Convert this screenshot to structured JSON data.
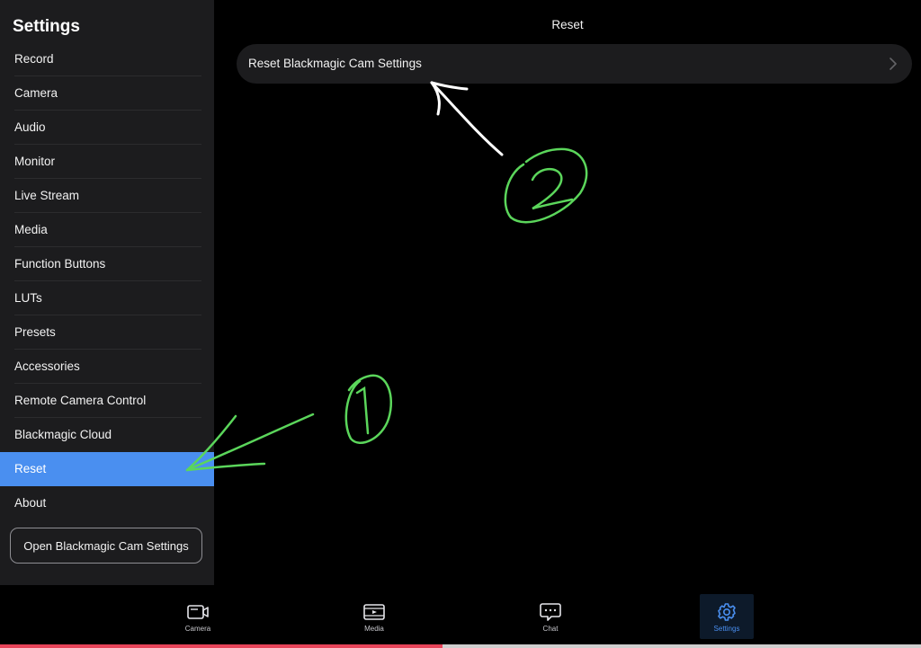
{
  "sidebar": {
    "title": "Settings",
    "items": [
      {
        "label": "Record"
      },
      {
        "label": "Camera"
      },
      {
        "label": "Audio"
      },
      {
        "label": "Monitor"
      },
      {
        "label": "Live Stream"
      },
      {
        "label": "Media"
      },
      {
        "label": "Function Buttons"
      },
      {
        "label": "LUTs"
      },
      {
        "label": "Presets"
      },
      {
        "label": "Accessories"
      },
      {
        "label": "Remote Camera Control"
      },
      {
        "label": "Blackmagic Cloud"
      },
      {
        "label": "Reset"
      },
      {
        "label": "About"
      }
    ],
    "selected": "Reset",
    "open_button_label": "Open Blackmagic Cam Settings"
  },
  "detail": {
    "title": "Reset",
    "row_label": "Reset Blackmagic Cam Settings"
  },
  "tabbar": {
    "tabs": [
      {
        "label": "Camera",
        "icon": "video-camera-icon"
      },
      {
        "label": "Media",
        "icon": "film-icon"
      },
      {
        "label": "Chat",
        "icon": "chat-bubble-icon"
      },
      {
        "label": "Settings",
        "icon": "gear-icon"
      }
    ],
    "active": "Settings"
  },
  "progress": {
    "fraction": 0.48
  },
  "colors": {
    "accent": "#4a8ff0",
    "annotation_green": "#5bd65b",
    "annotation_white": "#ffffff",
    "progress_red": "#e8455a"
  }
}
